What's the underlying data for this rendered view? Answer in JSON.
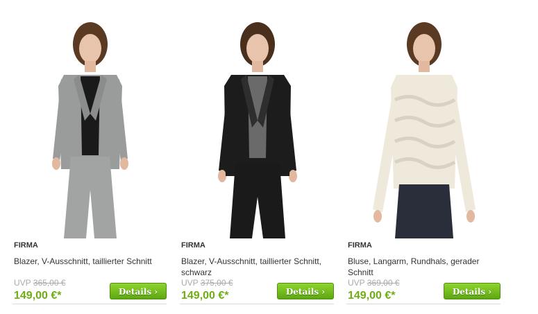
{
  "products": [
    {
      "brand": "FIRMA",
      "title": "Blazer, V-Ausschnitt, taillierter Schnitt",
      "uvp_label": "UVP",
      "old_price": "365,00 €",
      "price": "149,00 €*",
      "button": "Details ›",
      "jacket_color": "#9a9c9c",
      "inner_color": "#1a1a1a",
      "pants_color": "#a2a4a4"
    },
    {
      "brand": "FIRMA",
      "title": "Blazer, V-Ausschnitt, taillierter Schnitt, schwarz",
      "uvp_label": "UVP",
      "old_price": "375,00 €",
      "price": "149,00 €*",
      "button": "Details ›",
      "jacket_color": "#1c1c1c",
      "inner_color": "#6a6a6a",
      "pants_color": "#1a1a1a"
    },
    {
      "brand": "FIRMA",
      "title": "Bluse, Langarm, Rundhals, gerader Schnitt",
      "uvp_label": "UVP",
      "old_price": "369,00 €",
      "price": "149,00 €*",
      "button": "Details ›",
      "jacket_color": "#efe9dc",
      "inner_color": "#d9d2c2",
      "pants_color": "#2a2e3a"
    }
  ]
}
